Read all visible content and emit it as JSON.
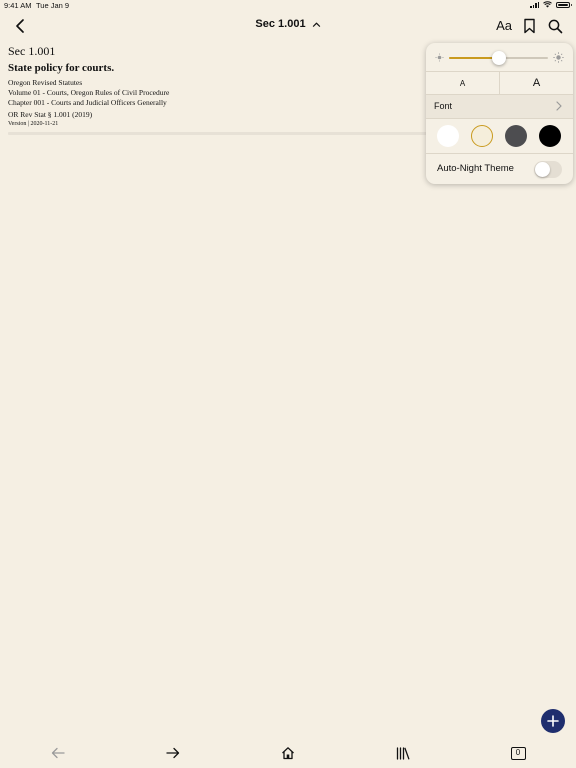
{
  "status_bar": {
    "time": "9:41 AM",
    "date": "Tue Jan 9",
    "battery_level": 1.0
  },
  "nav": {
    "title": "Sec 1.001",
    "text_settings_label": "Aa",
    "icons": [
      "back-chevron-icon",
      "chevron-up-icon",
      "bookmark-icon",
      "search-icon"
    ]
  },
  "document": {
    "section": "Sec 1.001",
    "heading": "State policy for courts.",
    "breadcrumb": [
      "Oregon Revised Statutes",
      "Volume 01 - Courts, Oregon Rules of Civil Procedure",
      "Chapter 001 - Courts and Judicial Officers Generally"
    ],
    "citation": "OR Rev Stat § 1.001 (2019)",
    "version": "Version | 2020-11-21"
  },
  "reader_settings": {
    "brightness": 0.5,
    "size_small_label": "A",
    "size_large_label": "A",
    "font_label": "Font",
    "themes": [
      {
        "name": "white",
        "color": "#ffffff",
        "selected": false
      },
      {
        "name": "sepia",
        "color": "#f5eedb",
        "selected": true
      },
      {
        "name": "gray",
        "color": "#4d4d50",
        "selected": false
      },
      {
        "name": "black",
        "color": "#000000",
        "selected": false
      }
    ],
    "auto_night_label": "Auto-Night Theme",
    "auto_night_enabled": false,
    "accent_color": "#c99a1e"
  },
  "fab": {
    "color": "#1f2e6e",
    "icon": "plus-icon"
  },
  "toolbar": {
    "icons": [
      "arrow-left-icon",
      "arrow-right-icon",
      "home-icon",
      "library-icon",
      "tabs-icon"
    ],
    "tab_count": "0"
  }
}
